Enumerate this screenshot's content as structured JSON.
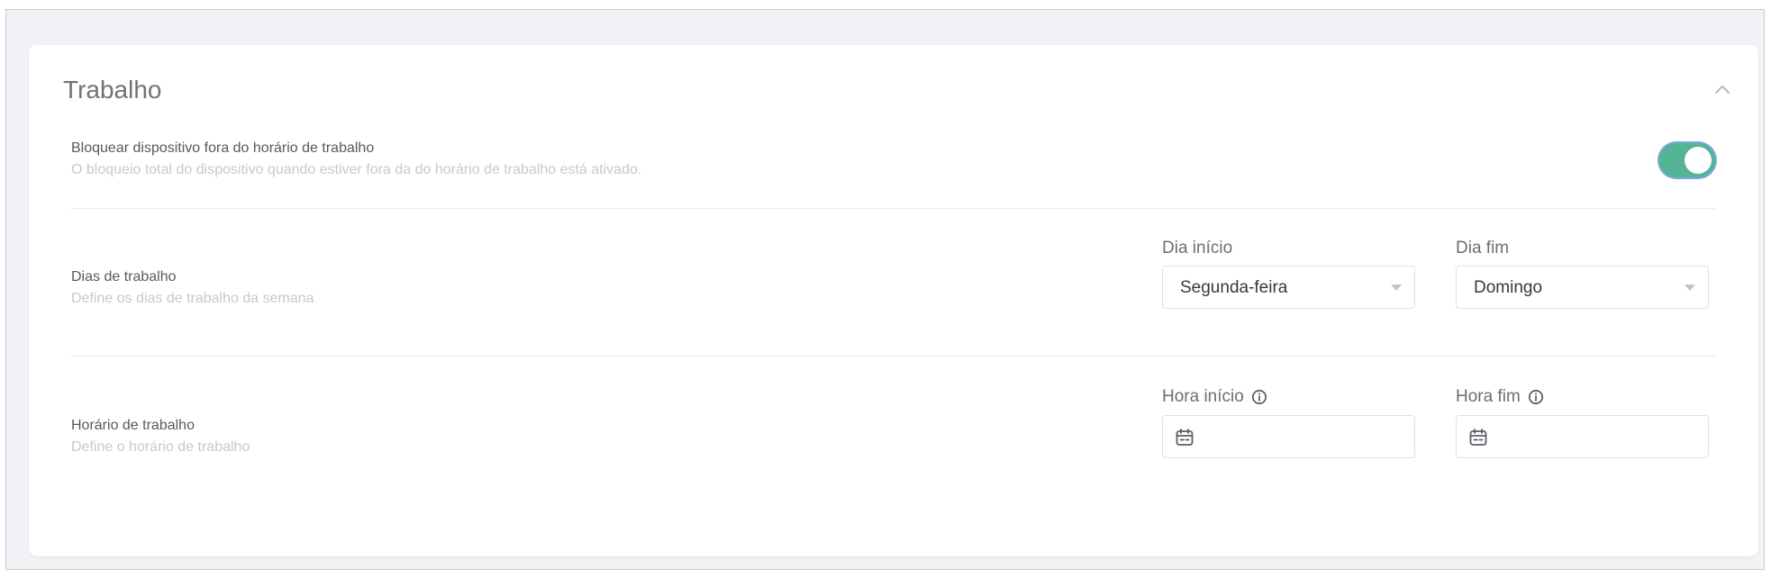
{
  "section": {
    "title": "Trabalho",
    "collapse_icon": "chevron-up-icon"
  },
  "block_device": {
    "label": "Bloquear dispositivo fora do horário de trabalho",
    "description": "O bloqueio total do dispositivo quando estiver fora da do horário de trabalho está ativado.",
    "toggle_on": true,
    "toggle_color": "#55b397"
  },
  "work_days": {
    "label": "Dias de trabalho",
    "description": "Define os dias de trabalho da semana",
    "start": {
      "label": "Dia início",
      "value": "Segunda-feira"
    },
    "end": {
      "label": "Dia fim",
      "value": "Domingo"
    }
  },
  "work_hours": {
    "label": "Horário de trabalho",
    "description": "Define o horário de trabalho",
    "start": {
      "label": "Hora início",
      "value": "",
      "icon": "calendar-icon",
      "info_icon": "info-icon"
    },
    "end": {
      "label": "Hora fim",
      "value": "",
      "icon": "calendar-icon",
      "info_icon": "info-icon"
    }
  }
}
